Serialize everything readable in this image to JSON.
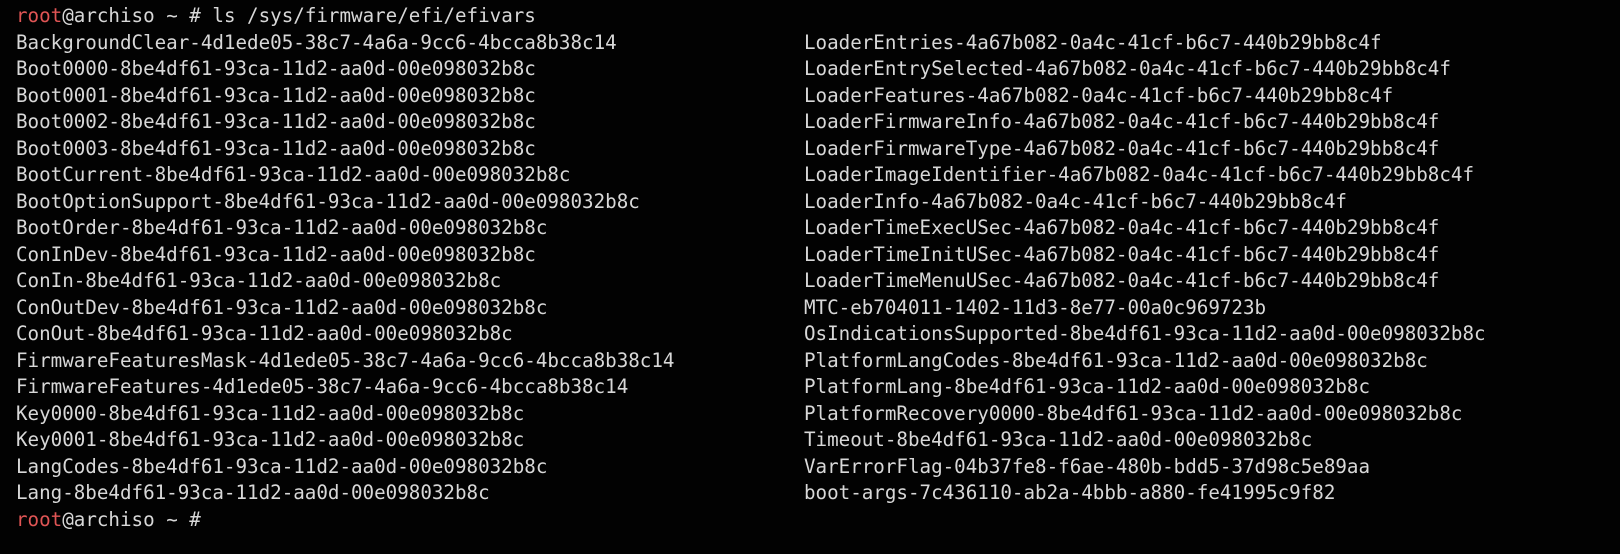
{
  "colors": {
    "background": "#020202",
    "text": "#d8d8d8",
    "prompt_user": "#e05555"
  },
  "prompt": {
    "user": "root",
    "host": "@archiso",
    "path": " ~ # "
  },
  "command": "ls /sys/firmware/efi/efivars",
  "listing": {
    "left": [
      "BackgroundClear-4d1ede05-38c7-4a6a-9cc6-4bcca8b38c14",
      "Boot0000-8be4df61-93ca-11d2-aa0d-00e098032b8c",
      "Boot0001-8be4df61-93ca-11d2-aa0d-00e098032b8c",
      "Boot0002-8be4df61-93ca-11d2-aa0d-00e098032b8c",
      "Boot0003-8be4df61-93ca-11d2-aa0d-00e098032b8c",
      "BootCurrent-8be4df61-93ca-11d2-aa0d-00e098032b8c",
      "BootOptionSupport-8be4df61-93ca-11d2-aa0d-00e098032b8c",
      "BootOrder-8be4df61-93ca-11d2-aa0d-00e098032b8c",
      "ConInDev-8be4df61-93ca-11d2-aa0d-00e098032b8c",
      "ConIn-8be4df61-93ca-11d2-aa0d-00e098032b8c",
      "ConOutDev-8be4df61-93ca-11d2-aa0d-00e098032b8c",
      "ConOut-8be4df61-93ca-11d2-aa0d-00e098032b8c",
      "FirmwareFeaturesMask-4d1ede05-38c7-4a6a-9cc6-4bcca8b38c14",
      "FirmwareFeatures-4d1ede05-38c7-4a6a-9cc6-4bcca8b38c14",
      "Key0000-8be4df61-93ca-11d2-aa0d-00e098032b8c",
      "Key0001-8be4df61-93ca-11d2-aa0d-00e098032b8c",
      "LangCodes-8be4df61-93ca-11d2-aa0d-00e098032b8c",
      "Lang-8be4df61-93ca-11d2-aa0d-00e098032b8c"
    ],
    "right": [
      "LoaderEntries-4a67b082-0a4c-41cf-b6c7-440b29bb8c4f",
      "LoaderEntrySelected-4a67b082-0a4c-41cf-b6c7-440b29bb8c4f",
      "LoaderFeatures-4a67b082-0a4c-41cf-b6c7-440b29bb8c4f",
      "LoaderFirmwareInfo-4a67b082-0a4c-41cf-b6c7-440b29bb8c4f",
      "LoaderFirmwareType-4a67b082-0a4c-41cf-b6c7-440b29bb8c4f",
      "LoaderImageIdentifier-4a67b082-0a4c-41cf-b6c7-440b29bb8c4f",
      "LoaderInfo-4a67b082-0a4c-41cf-b6c7-440b29bb8c4f",
      "LoaderTimeExecUSec-4a67b082-0a4c-41cf-b6c7-440b29bb8c4f",
      "LoaderTimeInitUSec-4a67b082-0a4c-41cf-b6c7-440b29bb8c4f",
      "LoaderTimeMenuUSec-4a67b082-0a4c-41cf-b6c7-440b29bb8c4f",
      "MTC-eb704011-1402-11d3-8e77-00a0c969723b",
      "OsIndicationsSupported-8be4df61-93ca-11d2-aa0d-00e098032b8c",
      "PlatformLangCodes-8be4df61-93ca-11d2-aa0d-00e098032b8c",
      "PlatformLang-8be4df61-93ca-11d2-aa0d-00e098032b8c",
      "PlatformRecovery0000-8be4df61-93ca-11d2-aa0d-00e098032b8c",
      "Timeout-8be4df61-93ca-11d2-aa0d-00e098032b8c",
      "VarErrorFlag-04b37fe8-f6ae-480b-bdd5-37d98c5e89aa",
      "boot-args-7c436110-ab2a-4bbb-a880-fe41995c9f82"
    ]
  }
}
